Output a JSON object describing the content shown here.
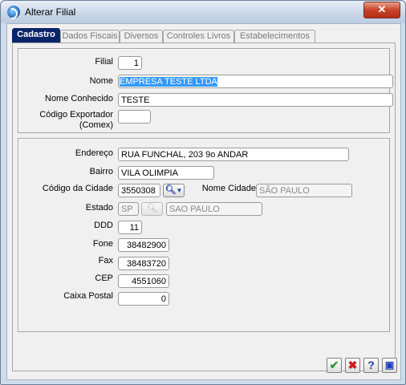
{
  "window": {
    "title": "Alterar Filial",
    "close_label": "✕"
  },
  "tabs": [
    "Cadastro",
    "Dados Fiscais",
    "Diversos",
    "Controles Livros",
    "Estabelecimentos"
  ],
  "group1": {
    "filial_label": "Filial",
    "filial_value": "1",
    "nome_label": "Nome",
    "nome_value": "EMPRESA TESTE LTDA",
    "nome_conhecido_label": "Nome Conhecido",
    "nome_conhecido_value": "TESTE",
    "codigo_exportador_label": "Código Exportador",
    "codigo_exportador_label2": "(Comex)",
    "codigo_exportador_value": ""
  },
  "group2": {
    "endereco_label": "Endereço",
    "endereco_value": "RUA FUNCHAL, 203 9o ANDAR",
    "bairro_label": "Bairro",
    "bairro_value": "VILA OLIMPIA",
    "codigo_cidade_label": "Código da Cidade",
    "codigo_cidade_value": "3550308",
    "nome_cidade_label": "Nome Cidade",
    "nome_cidade_value": "SÃO PAULO",
    "estado_label": "Estado",
    "estado_value": "SP",
    "estado_nome_value": "SAO PAULO",
    "ddd_label": "DDD",
    "ddd_value": "11",
    "fone_label": "Fone",
    "fone_value": "38482900",
    "fax_label": "Fax",
    "fax_value": "38483720",
    "cep_label": "CEP",
    "cep_value": "4551060",
    "caixa_postal_label": "Caixa Postal",
    "caixa_postal_value": "0"
  },
  "footer": {
    "ok_glyph": "✔",
    "cancel_glyph": "✖",
    "help_glyph": "?",
    "extra_glyph": "▣"
  },
  "colors": {
    "ok": "#2f9a2f",
    "cancel": "#d21a1a",
    "help": "#1d3fb0",
    "active_tab": "#0a246a"
  }
}
